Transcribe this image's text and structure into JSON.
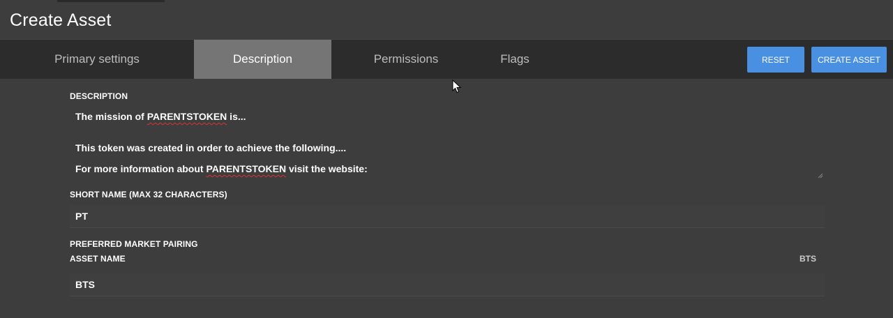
{
  "page": {
    "title": "Create Asset"
  },
  "tabs": [
    {
      "label": "Primary settings",
      "active": false
    },
    {
      "label": "Description",
      "active": true
    },
    {
      "label": "Permissions",
      "active": false
    },
    {
      "label": "Flags",
      "active": false
    }
  ],
  "actions": {
    "reset_label": "RESET",
    "create_label": "CREATE ASSET",
    "button_color": "#4a90e2"
  },
  "form": {
    "description": {
      "label": "DESCRIPTION",
      "line1_prefix": "The mission of ",
      "line1_token": "PARENTSTOKEN",
      "line1_suffix": " is...",
      "line2": "This token was created in order to achieve the following....",
      "line3_prefix": "For more information about ",
      "line3_token": "PARENTSTOKEN",
      "line3_suffix": " visit the website:"
    },
    "short_name": {
      "label": "SHORT NAME (MAX 32 CHARACTERS)",
      "value": "PT"
    },
    "market_pairing": {
      "label": "PREFERRED MARKET PAIRING",
      "asset_name_label": "ASSET NAME",
      "asset_side_label": "BTS",
      "value": "BTS"
    }
  },
  "icons": {
    "cursor": "mouse-pointer-icon",
    "resize": "resize-grip-icon"
  }
}
